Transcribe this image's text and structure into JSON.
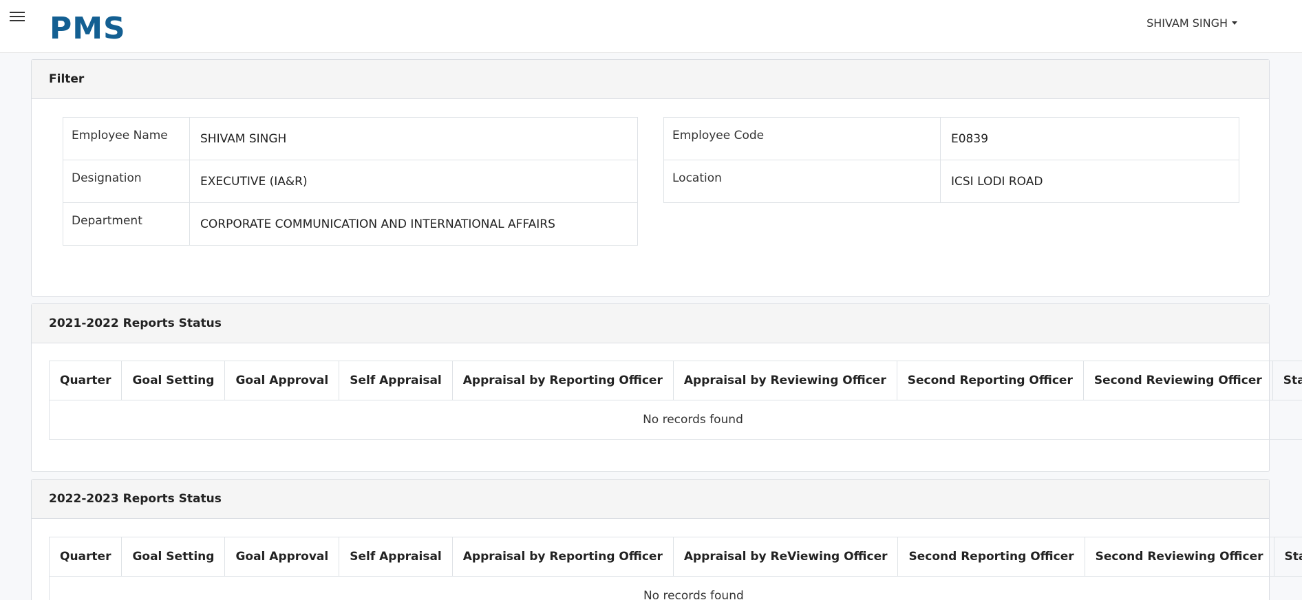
{
  "header": {
    "logo": "PMS",
    "user_name": "SHIVAM SINGH"
  },
  "filter": {
    "title": "Filter",
    "left": [
      {
        "label": "Employee Name",
        "value": "SHIVAM SINGH"
      },
      {
        "label": "Designation",
        "value": "EXECUTIVE (IA&R)"
      },
      {
        "label": "Department",
        "value": "CORPORATE COMMUNICATION AND INTERNATIONAL AFFAIRS"
      }
    ],
    "right": [
      {
        "label": "Employee Code",
        "value": "E0839"
      },
      {
        "label": "Location",
        "value": "ICSI LODI ROAD"
      }
    ]
  },
  "reports": [
    {
      "title": "2021-2022 Reports Status",
      "columns": [
        "Quarter",
        "Goal Setting",
        "Goal Approval",
        "Self Appraisal",
        "Appraisal by Reporting Officer",
        "Appraisal by Reviewing Officer",
        "Second Reporting Officer",
        "Second Reviewing Officer",
        "Status"
      ],
      "empty_text": "No records found"
    },
    {
      "title": "2022-2023 Reports Status",
      "columns": [
        "Quarter",
        "Goal Setting",
        "Goal Approval",
        "Self Appraisal",
        "Appraisal by Reporting Officer",
        "Appraisal by ReViewing Officer",
        "Second Reporting Officer",
        "Second Reviewing Officer",
        "Status"
      ],
      "empty_text": "No records found"
    }
  ]
}
